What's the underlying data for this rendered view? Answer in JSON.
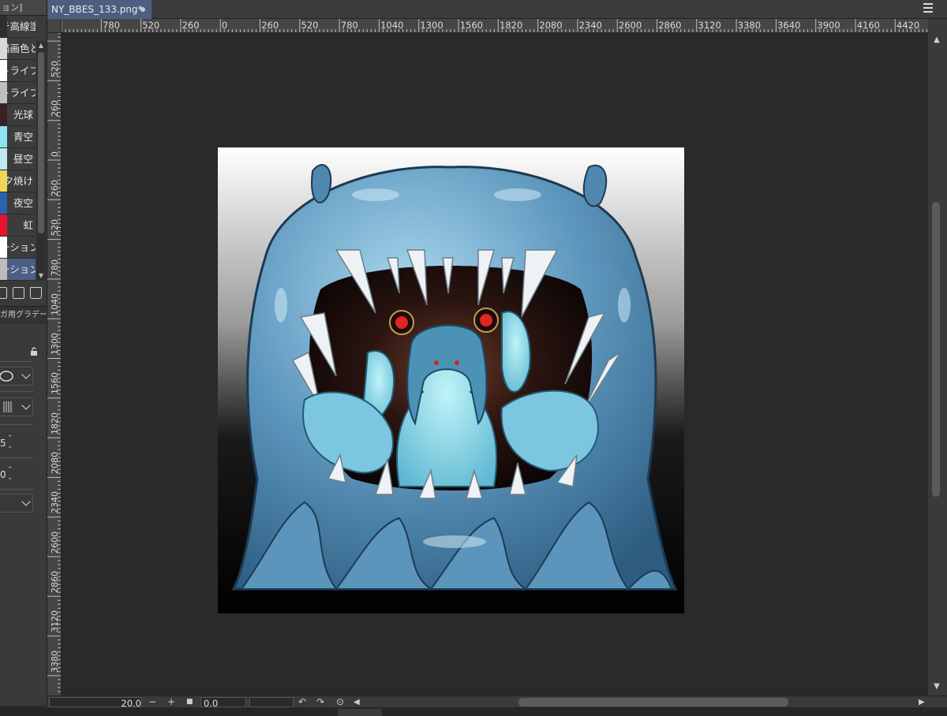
{
  "left_panel": {
    "title": "ョン]",
    "gradients": [
      {
        "label": "テ高線塗り",
        "swatch": "#2e2e2e"
      },
      {
        "label": "描画色と背景色",
        "swatch": "#d8d8d8"
      },
      {
        "label": "トライブ",
        "swatch": "#ffffff"
      },
      {
        "label": "トライブ",
        "swatch": "#bfbfbf"
      },
      {
        "label": "光球",
        "swatch": "#3a2020"
      },
      {
        "label": "青空",
        "swatch": "#8fe2f0"
      },
      {
        "label": "昼空",
        "swatch": "#bde8f4"
      },
      {
        "label": "夕焼け",
        "swatch": "#f1d55a"
      },
      {
        "label": "夜空",
        "swatch": "#2a62b0"
      },
      {
        "label": "虹",
        "swatch": "#e5132c"
      },
      {
        "label": "ーション",
        "swatch": "#ffffff"
      },
      {
        "label": "ーション",
        "swatch": "#bcbcbc"
      }
    ],
    "sub_header": "ガ用グラデー",
    "spin_values": [
      "5",
      "0"
    ]
  },
  "document": {
    "tab_label": "NY_BBES_133.png*"
  },
  "rulers": {
    "horizontal": [
      "780",
      "520",
      "260",
      "0",
      "260",
      "520",
      "780",
      "1040",
      "1300",
      "1560",
      "1820",
      "2080",
      "2340",
      "2600",
      "2860",
      "3120",
      "3380",
      "3640",
      "3900",
      "4160",
      "4420"
    ],
    "vertical": [
      "520",
      "260",
      "0",
      "260",
      "520",
      "780",
      "1040",
      "1300",
      "1560",
      "1820",
      "2080",
      "2340",
      "2600",
      "2860",
      "3120",
      "3380"
    ]
  },
  "bottom": {
    "zoom": "20.0",
    "zoom_out": "−",
    "zoom_in": "+",
    "angle": "0.0"
  },
  "colors": {
    "tab_active": "#4d5f80",
    "selected_item": "#4b5f86",
    "canvas_bg": "#2a2a2a"
  }
}
